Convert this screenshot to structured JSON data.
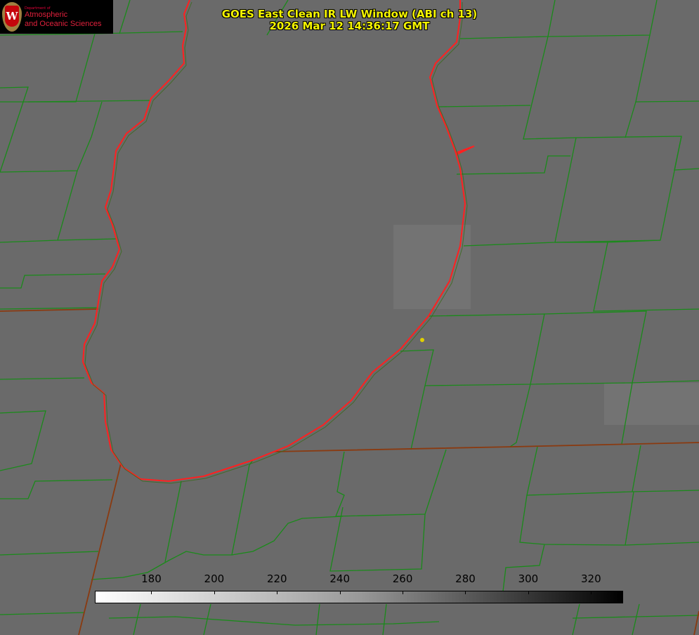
{
  "logo": {
    "dept": "Department of",
    "line1": "Atmospheric",
    "line2": "and Oceanic Sciences",
    "seal_letter": "W"
  },
  "title": {
    "line1": "GOES East Clean IR LW Window (ABI ch 13)",
    "line2": "2026 Mar 12 14:36:17 GMT"
  },
  "colorbar": {
    "min": 162,
    "max": 330,
    "ticks": [
      180,
      200,
      220,
      240,
      260,
      280,
      300,
      320
    ],
    "colors": {
      "low": "#ffffff",
      "high": "#000000"
    }
  },
  "colors": {
    "lake_outline": "#ff2020",
    "county_lines": "#1a8a1a",
    "marker": "#e0d000"
  }
}
